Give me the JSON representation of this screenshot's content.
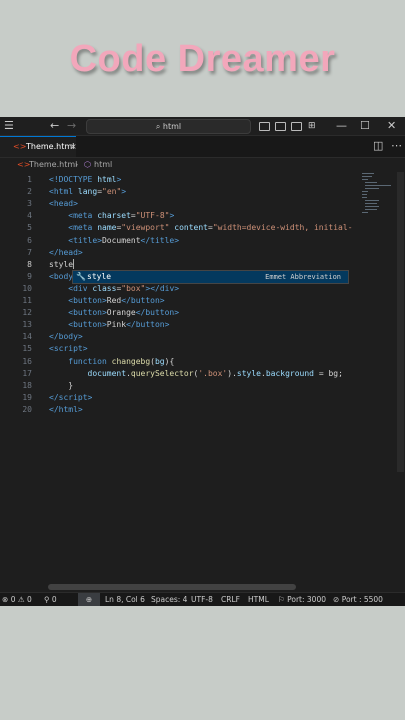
{
  "banner": {
    "title": "Code Dreamer"
  },
  "titlebar": {
    "search_text": "html"
  },
  "tab": {
    "label": "Theme.html"
  },
  "breadcrumb": {
    "file": "Theme.html",
    "element": "html"
  },
  "editor": {
    "lines": [
      {
        "n": "1",
        "html": "<span class=\"t\">&lt;!DOCTYPE</span> <span class=\"a\">html</span><span class=\"t\">&gt;</span>"
      },
      {
        "n": "2",
        "html": "<span class=\"t\">&lt;html</span> <span class=\"a\">lang</span><span class=\"x\">=</span><span class=\"s\">\"en\"</span><span class=\"t\">&gt;</span>"
      },
      {
        "n": "3",
        "html": "<span class=\"t\">&lt;head&gt;</span>"
      },
      {
        "n": "4",
        "html": "    <span class=\"t\">&lt;meta</span> <span class=\"a\">charset</span><span class=\"x\">=</span><span class=\"s\">\"UTF-8\"</span><span class=\"t\">&gt;</span>"
      },
      {
        "n": "5",
        "html": "    <span class=\"t\">&lt;meta</span> <span class=\"a\">name</span><span class=\"x\">=</span><span class=\"s\">\"viewport\"</span> <span class=\"a\">content</span><span class=\"x\">=</span><span class=\"s\">\"width=device-width, initial-</span>"
      },
      {
        "n": "6",
        "html": "    <span class=\"t\">&lt;title&gt;</span><span class=\"x\">Document</span><span class=\"t\">&lt;/title&gt;</span>"
      },
      {
        "n": "7",
        "html": "<span class=\"t\">&lt;/head&gt;</span>"
      },
      {
        "n": "8",
        "html": "<span class=\"x\">style</span><span class=\"caret\"></span>",
        "current": true
      },
      {
        "n": "9",
        "html": "<span class=\"t\">&lt;body</span>"
      },
      {
        "n": "10",
        "html": "    <span class=\"t\">&lt;div</span> <span class=\"a\">class</span><span class=\"x\">=</span><span class=\"s\">\"box\"</span><span class=\"t\">&gt;&lt;/div&gt;</span>"
      },
      {
        "n": "11",
        "html": "    <span class=\"t\">&lt;button&gt;</span><span class=\"x\">Red</span><span class=\"t\">&lt;/button&gt;</span>"
      },
      {
        "n": "12",
        "html": "    <span class=\"t\">&lt;button&gt;</span><span class=\"x\">Orange</span><span class=\"t\">&lt;/button&gt;</span>"
      },
      {
        "n": "13",
        "html": "    <span class=\"t\">&lt;button&gt;</span><span class=\"x\">Pink</span><span class=\"t\">&lt;/button&gt;</span>"
      },
      {
        "n": "14",
        "html": "<span class=\"t\">&lt;/body&gt;</span>"
      },
      {
        "n": "15",
        "html": "<span class=\"t\">&lt;script&gt;</span>"
      },
      {
        "n": "16",
        "html": "    <span class=\"k\">function</span> <span class=\"f\">changebg</span><span class=\"x\">(</span><span class=\"a\">bg</span><span class=\"x\">){</span>"
      },
      {
        "n": "17",
        "html": "        <span class=\"a\">document</span><span class=\"x\">.</span><span class=\"f\">querySelector</span><span class=\"x\">(</span><span class=\"s\">'.box'</span><span class=\"x\">).</span><span class=\"a\">style</span><span class=\"x\">.</span><span class=\"a\">background</span> <span class=\"x\">= bg;</span>"
      },
      {
        "n": "18",
        "html": "    <span class=\"x\">}</span>"
      },
      {
        "n": "19",
        "html": "<span class=\"t\">&lt;/script&gt;</span>"
      },
      {
        "n": "20",
        "html": "<span class=\"t\">&lt;/html&gt;</span>"
      }
    ]
  },
  "suggestion": {
    "label": "style",
    "kind": "Emmet Abbreviation"
  },
  "statusbar": {
    "errors": "0",
    "warnings": "0",
    "ports": "0",
    "position": "Ln 8, Col 6",
    "spaces": "Spaces: 4",
    "encoding": "UTF-8",
    "eol": "CRLF",
    "language": "HTML",
    "port1": "Port: 3000",
    "port2": "Port : 5500"
  },
  "colors": {
    "accent": "#0078d4",
    "banner_text": "#f2a7bb",
    "editor_bg": "#1e1e1e",
    "page_bg": "#c7ccc8"
  }
}
